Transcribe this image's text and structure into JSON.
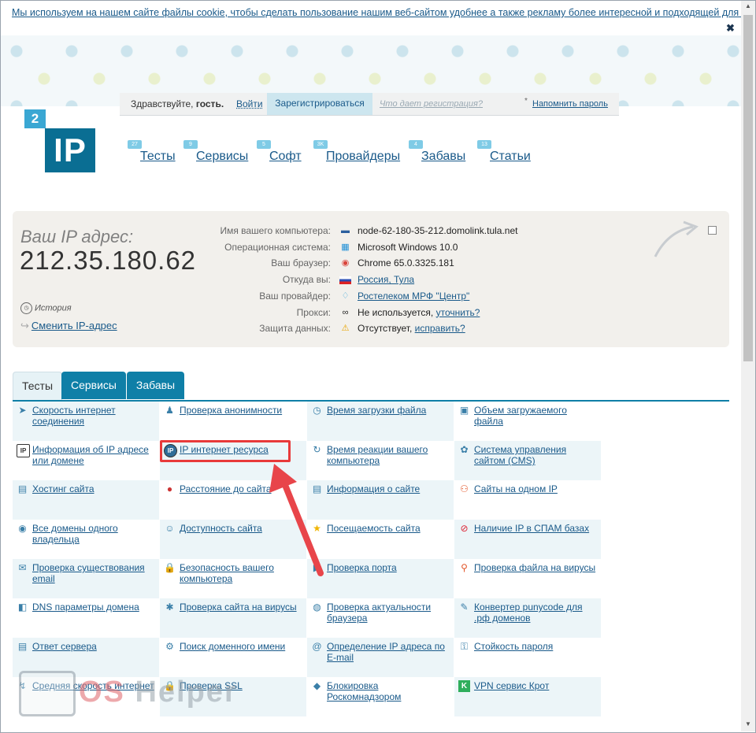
{
  "cookie": {
    "text": "Мы используем на нашем сайте файлы cookie, чтобы сделать пользование нашим веб-сайтом удобнее а также рекламу более интересной и подходящей для вас.",
    "close": "✖"
  },
  "login": {
    "greeting": "Здравствуйте,",
    "guest": "гость.",
    "login": "Войти",
    "register": "Зарегистрироваться",
    "why": "Что дает регистрация?",
    "star": "*",
    "remind": "Напомнить пароль"
  },
  "logo": {
    "two": "2",
    "ip": "IP"
  },
  "nav": [
    {
      "badge": "27",
      "label": "Тесты"
    },
    {
      "badge": "9",
      "label": "Сервисы"
    },
    {
      "badge": "5",
      "label": "Софт"
    },
    {
      "badge": "3K",
      "label": "Провайдеры"
    },
    {
      "badge": "4",
      "label": "Забавы"
    },
    {
      "badge": "13",
      "label": "Статьи"
    }
  ],
  "ip_panel": {
    "label": "Ваш IP адрес:",
    "ip": "212.35.180.62",
    "history": "История",
    "change": "Сменить IP-адрес",
    "rows": [
      {
        "label": "Имя вашего компьютера:",
        "icon": "computer-icon",
        "glyph": "▬",
        "value": "node-62-180-35-212.domolink.tula.net"
      },
      {
        "label": "Операционная система:",
        "icon": "windows-icon",
        "glyph": "▦",
        "value": "Microsoft Windows 10.0"
      },
      {
        "label": "Ваш браузер:",
        "icon": "chrome-icon",
        "glyph": "◉",
        "value": "Chrome 65.0.3325.181"
      },
      {
        "label": "Откуда вы:",
        "icon": "russia-flag-icon",
        "glyph": "▭",
        "value": "Россия, Тула",
        "link": true
      },
      {
        "label": "Ваш провайдер:",
        "icon": "provider-icon",
        "glyph": "♢",
        "value": "Ростелеком МРФ \"Центр\"",
        "link": true
      },
      {
        "label": "Прокси:",
        "icon": "glasses-icon",
        "glyph": "∞",
        "value": "Не используется,",
        "extra": "уточнить?"
      },
      {
        "label": "Защита данных:",
        "icon": "warning-icon",
        "glyph": "⚠",
        "value": "Отсутствует,",
        "extra": "исправить?"
      }
    ]
  },
  "tabs": [
    "Тесты",
    "Сервисы",
    "Забавы"
  ],
  "grid": [
    [
      "Скорость интернет соединения",
      "Проверка анонимности",
      "Время загрузки файла",
      "Объем загружаемого файла"
    ],
    [
      "Информация об IP адресе или домене",
      "IP интернет ресурса",
      "Время реакции вашего компьютера",
      "Система управления сайтом (CMS)"
    ],
    [
      "Хостинг сайта",
      "Расстояние до сайта",
      "Информация о сайте",
      "Сайты на одном IP"
    ],
    [
      "Все домены одного владельца",
      "Доступность сайта",
      "Посещаемость сайта",
      "Наличие IP в СПАМ базах"
    ],
    [
      "Проверка существования email",
      "Безопасность вашего компьютера",
      "Проверка порта",
      "Проверка файла на вирусы"
    ],
    [
      "DNS параметры домена",
      "Проверка сайта на вирусы",
      "Проверка актуальности браузера",
      "Конвертер punycode для .рф доменов"
    ],
    [
      "Ответ сервера",
      "Поиск доменного имени",
      "Определение IP адреса по E-mail",
      "Стойкость пароля"
    ],
    [
      "Средняя скорость интернет",
      "Проверка SSL",
      "Блокировка Роскомнадзором",
      "VPN сервис Крот"
    ]
  ],
  "grid_icons": [
    [
      "speed-icon",
      "anonymity-icon",
      "clock-icon",
      "file-size-icon"
    ],
    [
      "ip-info-icon",
      "ip-resource-icon",
      "reaction-icon",
      "cms-icon"
    ],
    [
      "hosting-icon",
      "pin-icon",
      "site-info-icon",
      "same-ip-icon"
    ],
    [
      "domains-icon",
      "availability-icon",
      "star-icon",
      "spam-icon"
    ],
    [
      "email-icon",
      "lock-icon",
      "port-icon",
      "virus-file-icon"
    ],
    [
      "dns-icon",
      "site-virus-icon",
      "browser-icon",
      "punycode-icon"
    ],
    [
      "server-icon",
      "domain-search-icon",
      "ip-email-icon",
      "password-icon"
    ],
    [
      "avg-speed-icon",
      "ssl-icon",
      "block-icon",
      "vpn-icon"
    ]
  ],
  "grid_glyphs": [
    [
      "➤",
      "♟",
      "◷",
      "▣"
    ],
    [
      "IP",
      "IP",
      "↻",
      "✿"
    ],
    [
      "▤",
      "●",
      "▤",
      "⚇"
    ],
    [
      "◉",
      "☺",
      "★",
      "⊘"
    ],
    [
      "✉",
      "🔒",
      "▶",
      "⚲"
    ],
    [
      "◧",
      "✱",
      "◍",
      "✎"
    ],
    [
      "▤",
      "⚙",
      "@",
      "⚿"
    ],
    [
      "↯",
      "🔒",
      "◆",
      "K"
    ]
  ],
  "watermark": {
    "os": "OS",
    "rest": " Helper"
  }
}
